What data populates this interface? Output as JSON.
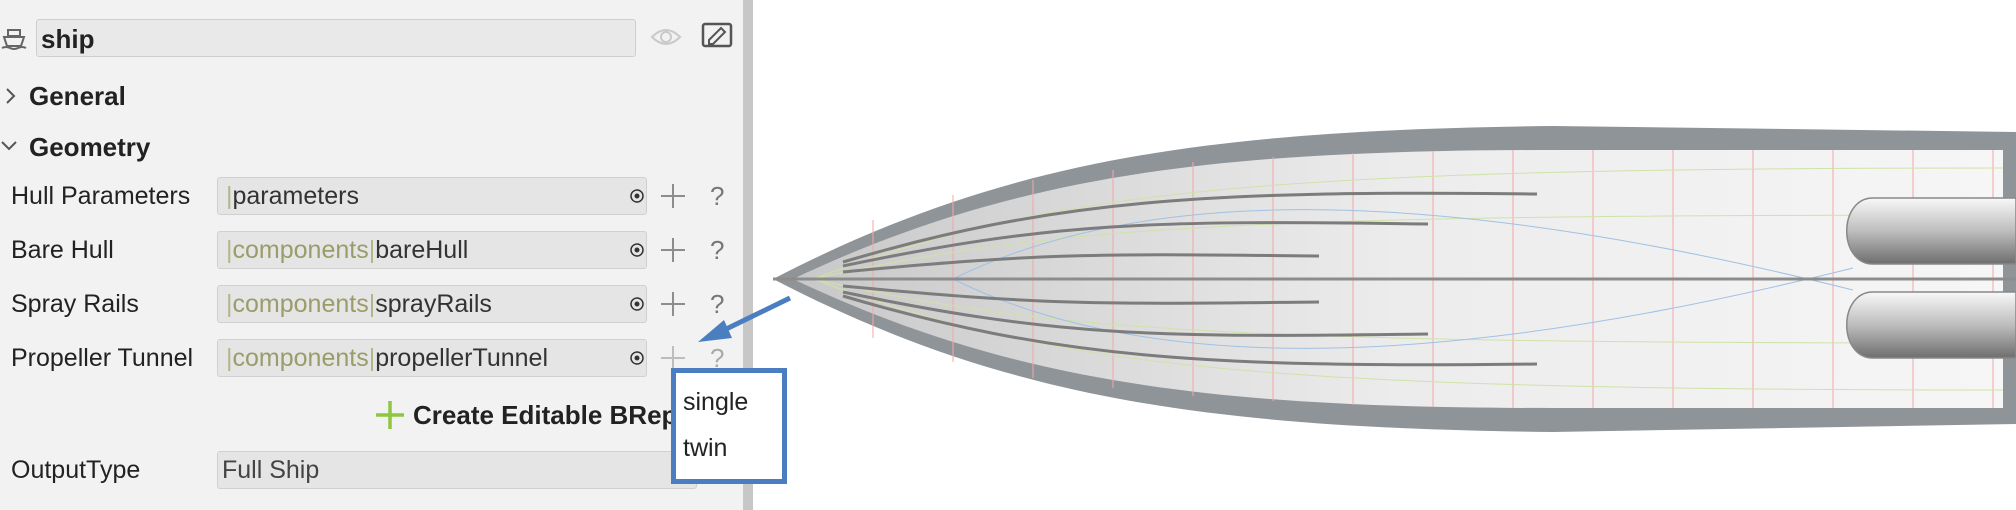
{
  "object": {
    "name": "ship"
  },
  "sections": {
    "general": "General",
    "geometry": "Geometry"
  },
  "properties": [
    {
      "label": "Hull Parameters",
      "prefix": "",
      "value": "parameters"
    },
    {
      "label": "Bare Hull",
      "prefix": "components",
      "value": "bareHull"
    },
    {
      "label": "Spray Rails",
      "prefix": "components",
      "value": "sprayRails"
    },
    {
      "label": "Propeller Tunnel",
      "prefix": "components",
      "value": "propellerTunnel"
    }
  ],
  "create_button": {
    "label": "Create Editable BRep"
  },
  "output": {
    "label": "OutputType",
    "value": "Full Ship"
  },
  "dropdown": {
    "options": [
      "single",
      "twin"
    ]
  },
  "colors": {
    "accent": "#4a7ec0",
    "plus_green": "#8dc63f",
    "hull_gray": "#8f9498"
  },
  "icons": [
    "ship-icon",
    "eye-icon",
    "edit-icon",
    "chevron-right-icon",
    "chevron-down-icon",
    "target-icon",
    "plus-icon",
    "help-icon",
    "arrow-pointer-icon"
  ]
}
